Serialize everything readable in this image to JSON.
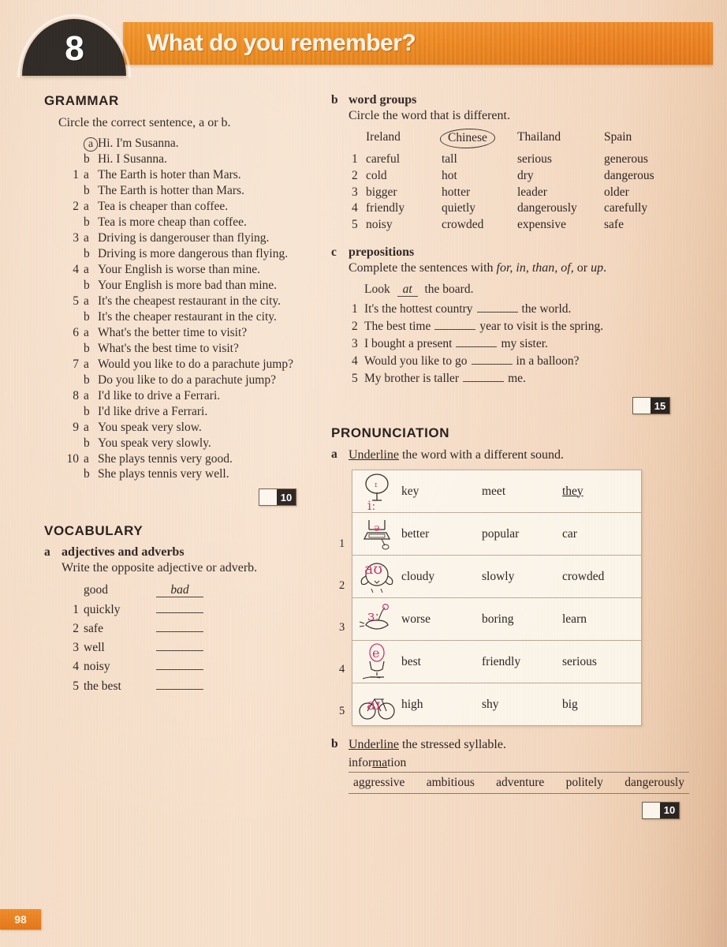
{
  "header": {
    "unit_number": "8",
    "title": "What do you remember?",
    "accent_color": "#e87e1d",
    "badge_color": "#2d2824"
  },
  "page_number": "98",
  "grammar": {
    "heading": "GRAMMAR",
    "instruction": "Circle the correct sentence, a or b.",
    "example": {
      "a": "Hi. I'm Susanna.",
      "b": "Hi. I Susanna.",
      "circled": "a"
    },
    "items": [
      {
        "n": "1",
        "a": "The Earth is hoter than Mars.",
        "b": "The Earth is hotter than Mars."
      },
      {
        "n": "2",
        "a": "Tea is cheaper than coffee.",
        "b": "Tea is more cheap than coffee."
      },
      {
        "n": "3",
        "a": "Driving is dangerouser than flying.",
        "b": "Driving is more dangerous than flying."
      },
      {
        "n": "4",
        "a": "Your English is worse than mine.",
        "b": "Your English is more bad than mine."
      },
      {
        "n": "5",
        "a": "It's the cheapest restaurant in the city.",
        "b": "It's the cheaper restaurant in the city."
      },
      {
        "n": "6",
        "a": "What's the better time to visit?",
        "b": "What's the best time to visit?"
      },
      {
        "n": "7",
        "a": "Would you like to do a parachute jump?",
        "b": "Do you like to do a parachute jump?"
      },
      {
        "n": "8",
        "a": "I'd like to drive a Ferrari.",
        "b": "I'd like drive a Ferrari."
      },
      {
        "n": "9",
        "a": "You speak very slow.",
        "b": "You speak very slowly."
      },
      {
        "n": "10",
        "a": "She plays tennis very good.",
        "b": "She plays tennis very well."
      }
    ],
    "score": "10"
  },
  "vocabulary": {
    "heading": "VOCABULARY",
    "a": {
      "letter": "a",
      "title": "adjectives and adverbs",
      "instruction": "Write the opposite adjective or adverb.",
      "example": {
        "word": "good",
        "answer": "bad"
      },
      "items": [
        {
          "n": "1",
          "word": "quickly",
          "answer": ""
        },
        {
          "n": "2",
          "word": "safe",
          "answer": ""
        },
        {
          "n": "3",
          "word": "well",
          "answer": ""
        },
        {
          "n": "4",
          "word": "noisy",
          "answer": ""
        },
        {
          "n": "5",
          "word": "the best",
          "answer": ""
        }
      ]
    },
    "b": {
      "letter": "b",
      "title": "word groups",
      "instruction": "Circle the word that is different.",
      "example_row": [
        "Ireland",
        "Chinese",
        "Thailand",
        "Spain"
      ],
      "example_circled": "Chinese",
      "rows": [
        {
          "n": "1",
          "words": [
            "careful",
            "tall",
            "serious",
            "generous"
          ]
        },
        {
          "n": "2",
          "words": [
            "cold",
            "hot",
            "dry",
            "dangerous"
          ]
        },
        {
          "n": "3",
          "words": [
            "bigger",
            "hotter",
            "leader",
            "older"
          ]
        },
        {
          "n": "4",
          "words": [
            "friendly",
            "quietly",
            "dangerously",
            "carefully"
          ]
        },
        {
          "n": "5",
          "words": [
            "noisy",
            "crowded",
            "expensive",
            "safe"
          ]
        }
      ]
    },
    "c": {
      "letter": "c",
      "title": "prepositions",
      "instruction_pre": "Complete the sentences with ",
      "instruction_words": "for, in, than, of,",
      "instruction_post": " or ",
      "instruction_last": "up",
      "instruction_end": ".",
      "example_pre": "Look",
      "example_answer": "at",
      "example_post": "the board.",
      "items": [
        {
          "n": "1",
          "pre": "It's the hottest country",
          "post": "the world."
        },
        {
          "n": "2",
          "pre": "The best time",
          "post": "year to visit is the spring."
        },
        {
          "n": "3",
          "pre": "I bought a present",
          "post": "my sister."
        },
        {
          "n": "4",
          "pre": "Would you like to go",
          "post": "in a balloon?"
        },
        {
          "n": "5",
          "pre": "My brother is taller",
          "post": "me."
        }
      ],
      "score": "15"
    }
  },
  "pronunciation": {
    "heading": "PRONUNCIATION",
    "a": {
      "letter": "a",
      "instruction_underlined": "Underline",
      "instruction_rest": " the word with a different sound.",
      "rows": [
        {
          "n": "",
          "icon": "tree-icon",
          "symbol": "iː",
          "words": [
            "key",
            "meet",
            "they"
          ],
          "underlined": "they"
        },
        {
          "n": "1",
          "icon": "computer-icon",
          "symbol": "ə",
          "words": [
            "better",
            "popular",
            "car"
          ],
          "underlined": ""
        },
        {
          "n": "2",
          "icon": "owl-icon",
          "symbol": "aʊ",
          "words": [
            "cloudy",
            "slowly",
            "crowded"
          ],
          "underlined": ""
        },
        {
          "n": "3",
          "icon": "bird-icon",
          "symbol": "ɜː",
          "words": [
            "worse",
            "boring",
            "learn"
          ],
          "underlined": ""
        },
        {
          "n": "4",
          "icon": "egg-icon",
          "symbol": "e",
          "words": [
            "best",
            "friendly",
            "serious"
          ],
          "underlined": ""
        },
        {
          "n": "5",
          "icon": "bike-icon",
          "symbol": "aɪ",
          "words": [
            "high",
            "shy",
            "big"
          ],
          "underlined": ""
        }
      ]
    },
    "b": {
      "letter": "b",
      "instruction_underlined": "Underline",
      "instruction_rest": " the stressed syllable.",
      "example_pre": "infor",
      "example_stress": "ma",
      "example_post": "tion",
      "words": [
        "aggressive",
        "ambitious",
        "adventure",
        "politely",
        "dangerously"
      ],
      "score": "10"
    }
  }
}
